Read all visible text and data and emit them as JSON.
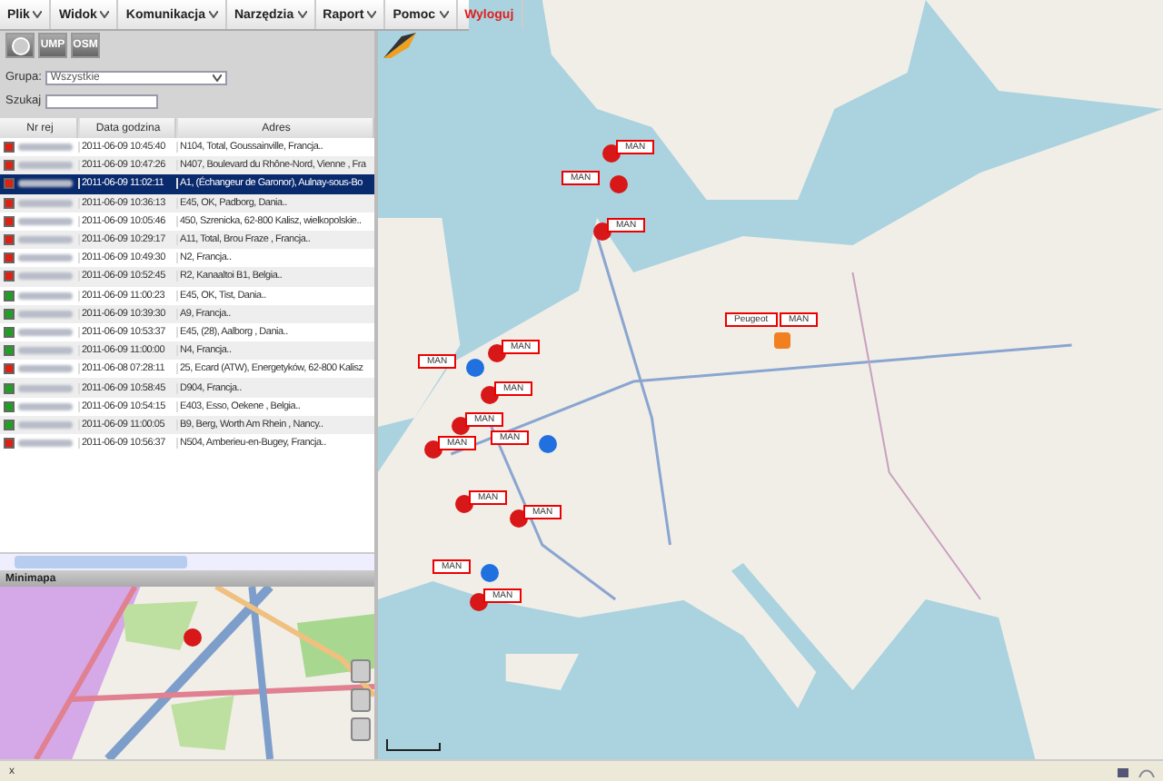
{
  "menu": [
    {
      "label": "Plik",
      "kind": "menu"
    },
    {
      "label": "Widok",
      "kind": "menu"
    },
    {
      "label": "Komunikacja",
      "kind": "menu"
    },
    {
      "label": "Narzędzia",
      "kind": "menu"
    },
    {
      "label": "Raport",
      "kind": "menu"
    },
    {
      "label": "Pomoc",
      "kind": "menu"
    },
    {
      "label": "Wyloguj",
      "kind": "action"
    }
  ],
  "toolbar": [
    {
      "kind": "globe"
    },
    {
      "label": "UMP",
      "kind": "text"
    },
    {
      "label": "OSM",
      "kind": "text"
    }
  ],
  "filter": {
    "group_label": "Grupa:",
    "group_value": "Wszystkie",
    "search_label": "Szukaj"
  },
  "table": {
    "columns": [
      "Nr rej",
      "Data godzina",
      "Adres"
    ],
    "rows": [
      {
        "color": "#e02010",
        "time": "2011-06-09 10:45:40",
        "address": "N104, Total, Goussainville, Francja..",
        "selected": false
      },
      {
        "color": "#e02010",
        "time": "2011-06-09 10:47:26",
        "address": "N407, Boulevard du Rhône-Nord, Vienne , Fra",
        "selected": false
      },
      {
        "color": "#e02010",
        "time": "2011-06-09 11:02:11",
        "address": "A1, (Échangeur de Garonor), Aulnay-sous-Bo",
        "selected": true
      },
      {
        "color": "#e02010",
        "time": "2011-06-09 10:36:13",
        "address": "E45, OK, Padborg, Dania..",
        "selected": false
      },
      {
        "color": "#e02010",
        "time": "2011-06-09 10:05:46",
        "address": "450, Szrenicka, 62-800 Kalisz, wielkopolskie..",
        "selected": false
      },
      {
        "color": "#e02010",
        "time": "2011-06-09 10:29:17",
        "address": "A11, Total, Brou Fraze , Francja..",
        "selected": false
      },
      {
        "color": "#e02010",
        "time": "2011-06-09 10:49:30",
        "address": "N2, Francja..",
        "selected": false
      },
      {
        "color": "#e02010",
        "time": "2011-06-09 10:52:45",
        "address": "R2, Kanaaltoi B1, Belgia..",
        "selected": false
      },
      {
        "color": "#20a020",
        "time": "2011-06-09 11:00:23",
        "address": "E45, OK, Tist, Dania..",
        "selected": false
      },
      {
        "color": "#20a020",
        "time": "2011-06-09 10:39:30",
        "address": "A9, Francja..",
        "selected": false
      },
      {
        "color": "#20a020",
        "time": "2011-06-09 10:53:37",
        "address": "E45, (28), Aalborg , Dania..",
        "selected": false
      },
      {
        "color": "#20a020",
        "time": "2011-06-09 11:00:00",
        "address": "N4, Francja..",
        "selected": false
      },
      {
        "color": "#e02010",
        "time": "2011-06-08 07:28:11",
        "address": "25, Ecard (ATW), Energetyków, 62-800 Kalisz",
        "selected": false
      },
      {
        "color": "#20a020",
        "time": "2011-06-09 10:58:45",
        "address": "D904, Francja..",
        "selected": false
      },
      {
        "color": "#20a020",
        "time": "2011-06-09 10:54:15",
        "address": "E403, Esso, Oekene , Belgia..",
        "selected": false
      },
      {
        "color": "#20a020",
        "time": "2011-06-09 11:00:05",
        "address": "B9, Berg, Worth Am Rhein , Nancy..",
        "selected": false
      },
      {
        "color": "#e02010",
        "time": "2011-06-09 10:56:37",
        "address": "N504, Amberieu-en-Bugey, Francja..",
        "selected": false
      }
    ]
  },
  "minimap": {
    "title": "Minimapa",
    "close": "x"
  },
  "map": {
    "markers": [
      {
        "kind": "stopped",
        "labels": [
          "MAN"
        ]
      },
      {
        "kind": "stopped",
        "labels": [
          "MAN"
        ]
      },
      {
        "kind": "stopped",
        "labels": [
          "MAN"
        ]
      },
      {
        "kind": "parked",
        "labels": [
          "Peugeot",
          "MAN"
        ]
      },
      {
        "kind": "stopped",
        "labels": [
          "MAN"
        ]
      },
      {
        "kind": "moving",
        "labels": [
          "MAN"
        ]
      },
      {
        "kind": "stopped",
        "labels": [
          "MAN"
        ]
      },
      {
        "kind": "stopped",
        "labels": [
          "MAN"
        ]
      },
      {
        "kind": "moving",
        "labels": [
          "MAN"
        ]
      },
      {
        "kind": "stopped",
        "labels": [
          "MAN"
        ]
      },
      {
        "kind": "stopped",
        "labels": [
          "MAN"
        ]
      },
      {
        "kind": "stopped",
        "labels": [
          "MAN"
        ]
      },
      {
        "kind": "moving",
        "labels": [
          "MAN"
        ]
      },
      {
        "kind": "stopped",
        "labels": [
          "MAN"
        ]
      }
    ]
  }
}
